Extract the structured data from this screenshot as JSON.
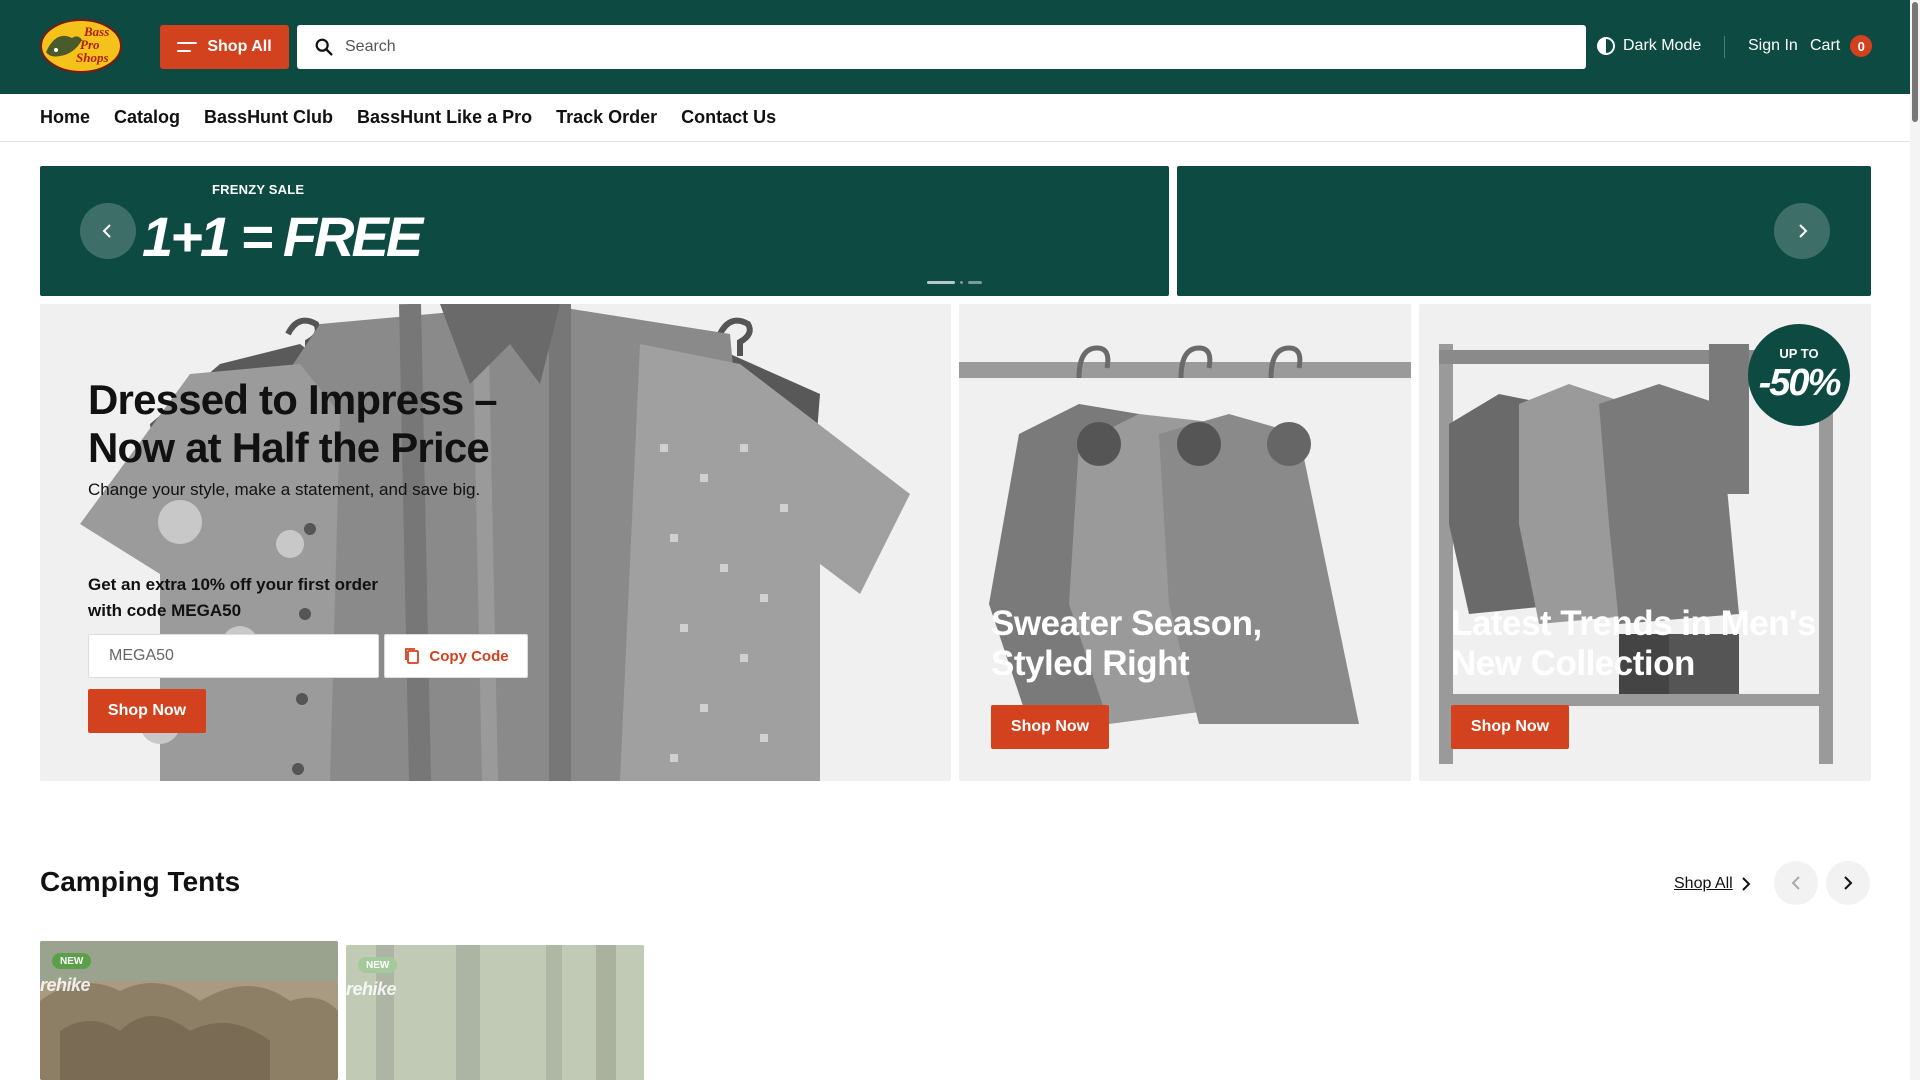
{
  "header": {
    "logo_icon": "bass-pro-shops-logo",
    "shop_all_label": "Shop All",
    "search_placeholder": "Search",
    "dark_mode_label": "Dark Mode",
    "sign_in_label": "Sign In",
    "cart_label": "Cart",
    "cart_count": "0",
    "colors": {
      "header_bg": "#0d4a41",
      "accent": "#d2421f"
    }
  },
  "nav": {
    "items": [
      "Home",
      "Catalog",
      "BassHunt Club",
      "BassHunt Like a Pro",
      "Track Order",
      "Contact Us"
    ]
  },
  "banner": {
    "kicker": "FRENZY SALE",
    "headline": "1+1 = FREE",
    "slides": 3,
    "active_slide": 1
  },
  "promos": {
    "main": {
      "title_line1": "Dressed to Impress –",
      "title_line2": "Now at Half the Price",
      "subtitle": "Change your style, make a statement, and save big.",
      "offer_line1": "Get an extra 10% off your first order",
      "offer_line2": "with code MEGA50",
      "code_value": "MEGA50",
      "copy_label": "Copy Code",
      "shop_label": "Shop Now"
    },
    "sweater": {
      "title_line1": "Sweater Season,",
      "title_line2": "Styled Right",
      "shop_label": "Shop Now"
    },
    "mens": {
      "title_line1": "Latest Trends in Men's",
      "title_line2": "New Collection",
      "shop_label": "Shop Now",
      "badge_top": "UP TO",
      "badge_value": "-50%"
    }
  },
  "camping": {
    "title": "Camping Tents",
    "shop_all_label": "Shop All",
    "products": [
      {
        "badge": "NEW",
        "brand": "rehike"
      },
      {
        "badge": "NEW",
        "brand": "rehike"
      }
    ]
  }
}
